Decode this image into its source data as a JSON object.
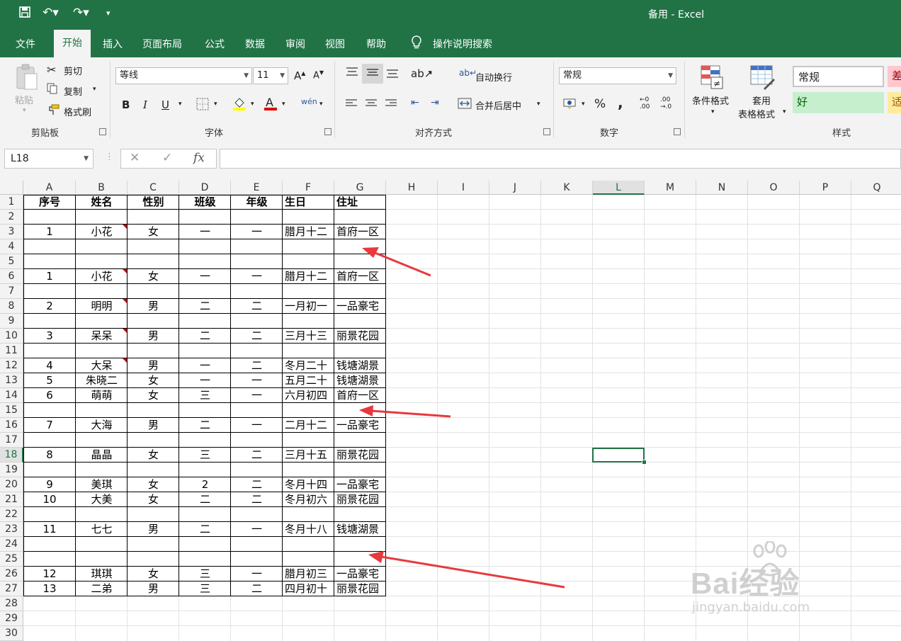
{
  "window": {
    "title": "备用 - Excel"
  },
  "tabs": [
    "文件",
    "开始",
    "插入",
    "页面布局",
    "公式",
    "数据",
    "审阅",
    "视图",
    "帮助"
  ],
  "tell_me": "操作说明搜索",
  "ribbon": {
    "clipboard": {
      "paste": "粘贴",
      "cut": "剪切",
      "copy": "复制",
      "format_painter": "格式刷",
      "label": "剪贴板"
    },
    "font": {
      "name": "等线",
      "size": "11",
      "label": "字体"
    },
    "alignment": {
      "wrap": "自动换行",
      "merge": "合并后居中",
      "label": "对齐方式"
    },
    "number": {
      "format": "常规",
      "label": "数字"
    },
    "styles": {
      "cond_format": "条件格式",
      "table_format_1": "套用",
      "table_format_2": "表格格式",
      "normal": "常规",
      "bad": "差",
      "good": "好",
      "neutral": "适",
      "label": "样式"
    }
  },
  "formula_bar": {
    "name_box": "L18",
    "fx": "fx",
    "value": ""
  },
  "columns": [
    "A",
    "B",
    "C",
    "D",
    "E",
    "F",
    "G",
    "H",
    "I",
    "J",
    "K",
    "L",
    "M",
    "N",
    "O",
    "P",
    "Q"
  ],
  "rows": [
    "1",
    "2",
    "3",
    "4",
    "5",
    "6",
    "7",
    "8",
    "9",
    "10",
    "11",
    "12",
    "13",
    "14",
    "15",
    "16",
    "17",
    "18",
    "19",
    "20",
    "21",
    "22",
    "23",
    "24",
    "25",
    "26",
    "27",
    "28",
    "29",
    "30"
  ],
  "selected": {
    "col": "L",
    "row": "18"
  },
  "table": {
    "headers": [
      "序号",
      "姓名",
      "性别",
      "班级",
      "年级",
      "生日",
      "住址"
    ],
    "rows": [
      {
        "row": 3,
        "cells": [
          "1",
          "小花",
          "女",
          "一",
          "一",
          "腊月十二",
          "首府一区"
        ],
        "comment": true
      },
      {
        "row": 6,
        "cells": [
          "1",
          "小花",
          "女",
          "一",
          "一",
          "腊月十二",
          "首府一区"
        ],
        "comment": true
      },
      {
        "row": 8,
        "cells": [
          "2",
          "明明",
          "男",
          "二",
          "二",
          "一月初一",
          "一品豪宅"
        ],
        "comment": true
      },
      {
        "row": 10,
        "cells": [
          "3",
          "呆呆",
          "男",
          "二",
          "二",
          "三月十三",
          "丽景花园"
        ],
        "comment": true
      },
      {
        "row": 12,
        "cells": [
          "4",
          "大呆",
          "男",
          "一",
          "二",
          "冬月二十",
          "钱塘湖景"
        ],
        "comment": true
      },
      {
        "row": 13,
        "cells": [
          "5",
          "朱晓二",
          "女",
          "一",
          "一",
          "五月二十",
          "钱塘湖景"
        ]
      },
      {
        "row": 14,
        "cells": [
          "6",
          "萌萌",
          "女",
          "三",
          "一",
          "六月初四",
          "首府一区"
        ]
      },
      {
        "row": 16,
        "cells": [
          "7",
          "大海",
          "男",
          "二",
          "一",
          "二月十二",
          "一品豪宅"
        ]
      },
      {
        "row": 18,
        "cells": [
          "8",
          "晶晶",
          "女",
          "三",
          "二",
          "三月十五",
          "丽景花园"
        ]
      },
      {
        "row": 20,
        "cells": [
          "9",
          "美琪",
          "女",
          "2",
          "二",
          "冬月十四",
          "一品豪宅"
        ]
      },
      {
        "row": 21,
        "cells": [
          "10",
          "大美",
          "女",
          "二",
          "二",
          "冬月初六",
          "丽景花园"
        ]
      },
      {
        "row": 23,
        "cells": [
          "11",
          "七七",
          "男",
          "二",
          "一",
          "冬月十八",
          "钱塘湖景"
        ]
      },
      {
        "row": 26,
        "cells": [
          "12",
          "琪琪",
          "女",
          "三",
          "一",
          "腊月初三",
          "一品豪宅"
        ]
      },
      {
        "row": 27,
        "cells": [
          "13",
          "二弟",
          "男",
          "三",
          "二",
          "四月初十",
          "丽景花园"
        ]
      }
    ]
  },
  "watermark": {
    "brand": "Bai经验",
    "url": "jingyan.baidu.com"
  },
  "colors": {
    "excel_green": "#217346",
    "arrow": "#e8393d",
    "comment_marker": "#c00000"
  }
}
